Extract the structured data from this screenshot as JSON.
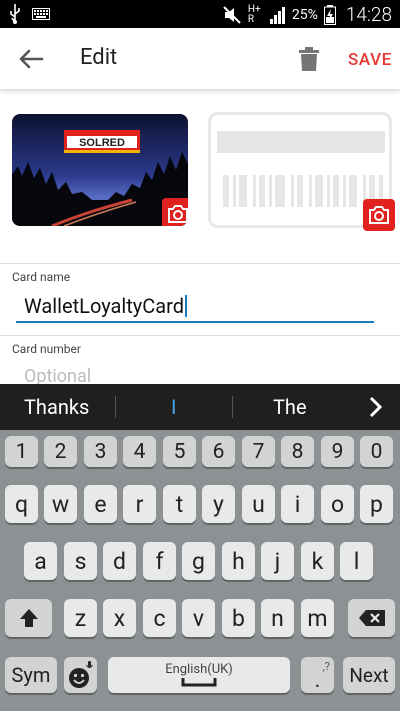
{
  "status_bar": {
    "network": "H+ R",
    "battery": "25%",
    "time": "14:28"
  },
  "app_bar": {
    "title": "Edit",
    "save_label": "SAVE"
  },
  "card_images": {
    "front_brand": "SOLRED"
  },
  "form": {
    "card_name_label": "Card name",
    "card_name_value": "WalletLoyaltyCard",
    "card_number_label": "Card number",
    "card_number_placeholder": "Optional"
  },
  "keyboard": {
    "suggestions": [
      "Thanks",
      "I",
      "The"
    ],
    "row_numbers": [
      "1",
      "2",
      "3",
      "4",
      "5",
      "6",
      "7",
      "8",
      "9",
      "0"
    ],
    "row1": [
      "q",
      "w",
      "e",
      "r",
      "t",
      "y",
      "u",
      "i",
      "o",
      "p"
    ],
    "row2": [
      "a",
      "s",
      "d",
      "f",
      "g",
      "h",
      "j",
      "k",
      "l"
    ],
    "row3": [
      "z",
      "x",
      "c",
      "v",
      "b",
      "n",
      "m"
    ],
    "sym_label": "Sym",
    "space_label": "English(UK)",
    "next_label": "Next",
    "period_label": ".",
    "period_alt": ",?"
  },
  "colors": {
    "accent": "#e53935",
    "focus": "#1a7bbd"
  }
}
